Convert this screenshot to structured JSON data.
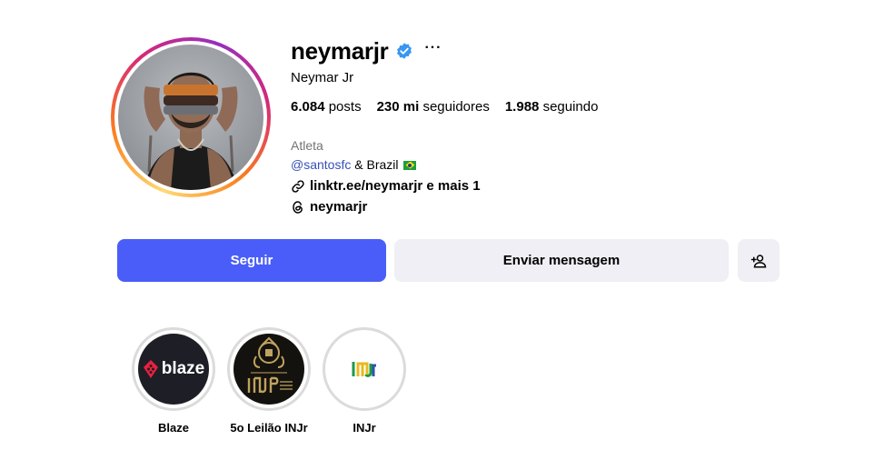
{
  "profile": {
    "username": "neymarjr",
    "full_name": "Neymar Jr",
    "more_label": "···",
    "stats": {
      "posts_count": "6.084",
      "posts_label": "posts",
      "followers_count": "230 mi",
      "followers_label": "seguidores",
      "following_count": "1.988",
      "following_label": "seguindo"
    },
    "bio": {
      "category": "Atleta",
      "mention": "@santosfc",
      "line2_rest": "& Brazil",
      "link": "linktr.ee/neymarjr e mais 1",
      "threads": "neymarjr"
    }
  },
  "actions": {
    "follow": "Seguir",
    "message": "Enviar mensagem"
  },
  "highlights": [
    {
      "label": "Blaze",
      "logo_text": "blaze"
    },
    {
      "label": "5o Leilão INJr"
    },
    {
      "label": "INJr"
    }
  ],
  "colors": {
    "follow_button": "#4a5df9",
    "secondary_button": "#efeff5",
    "mention_link": "#3850b7",
    "verified_badge": "#3897f0",
    "category_text": "#737373"
  },
  "icons": {
    "verified": "verified-badge-icon",
    "link": "link-icon",
    "threads": "threads-icon",
    "suggest": "add-person-icon",
    "flag": "brazil-flag-icon"
  }
}
